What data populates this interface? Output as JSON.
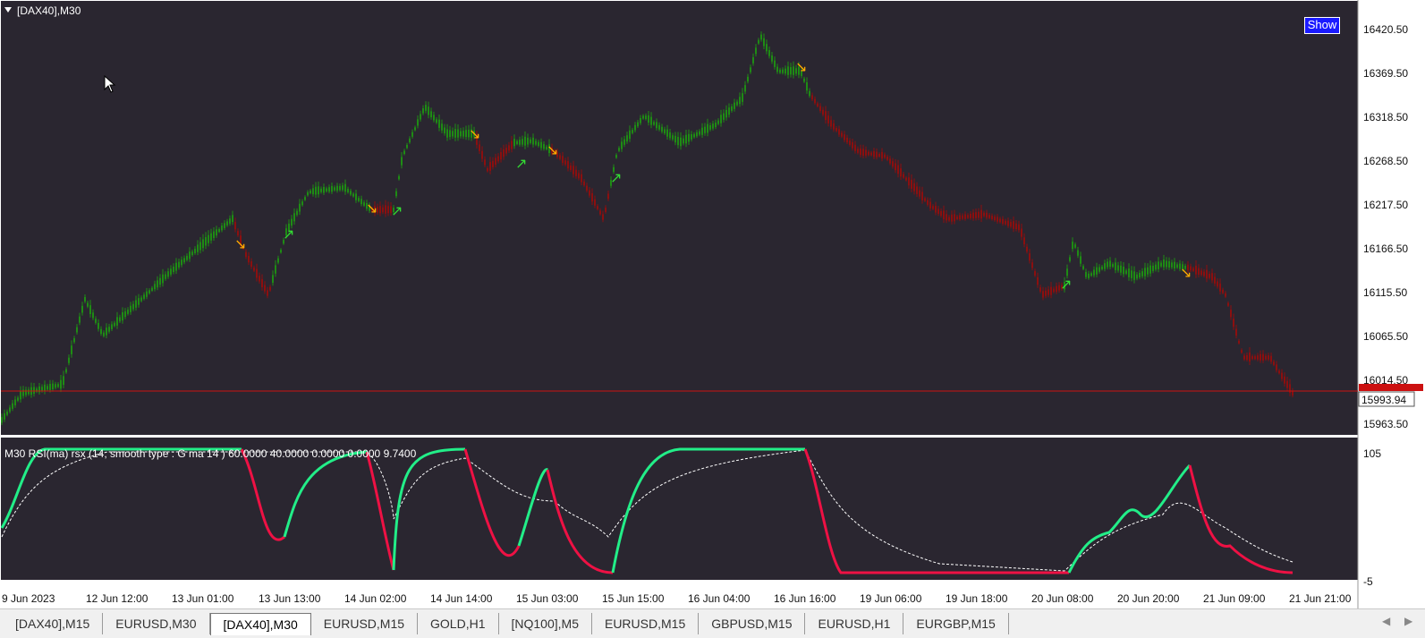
{
  "chart": {
    "title": "[DAX40],M30",
    "show_button": "Show",
    "current_price": "15993.94",
    "price_levels": [
      "16420.50",
      "16369.50",
      "16318.50",
      "16268.50",
      "16217.50",
      "16166.50",
      "16115.50",
      "16065.50",
      "16014.50",
      "15963.50"
    ],
    "time_labels": [
      "9 Jun 2023",
      "12 Jun 12:00",
      "13 Jun 01:00",
      "13 Jun 13:00",
      "14 Jun 02:00",
      "14 Jun 14:00",
      "15 Jun 03:00",
      "15 Jun 15:00",
      "16 Jun 04:00",
      "16 Jun 16:00",
      "19 Jun 06:00",
      "19 Jun 18:00",
      "20 Jun 08:00",
      "20 Jun 20:00",
      "21 Jun 09:00",
      "21 Jun 21:00"
    ]
  },
  "indicator": {
    "label": "M30 RSI(ma) rsx (14, smooth type : G ma  14 ) 60.0000 40.0000 0.0000 0.0000 9.7400",
    "scale_top": "105",
    "scale_bottom": "-5"
  },
  "colors": {
    "background": "#2a2630",
    "bull": "#1e8c14",
    "bear": "#8c0f0f",
    "up_arrow": "#33dd33",
    "down_arrow": "#ffaa00",
    "rsi_up": "#22ee88",
    "rsi_down": "#ee1144",
    "price_line": "#cc1111"
  },
  "tabs": [
    {
      "label": "[DAX40],M15",
      "active": false
    },
    {
      "label": "EURUSD,M30",
      "active": false
    },
    {
      "label": "[DAX40],M30",
      "active": true
    },
    {
      "label": "EURUSD,M15",
      "active": false
    },
    {
      "label": "GOLD,H1",
      "active": false
    },
    {
      "label": "[NQ100],M5",
      "active": false
    },
    {
      "label": "EURUSD,M15",
      "active": false
    },
    {
      "label": "GBPUSD,M15",
      "active": false
    },
    {
      "label": "EURUSD,H1",
      "active": false
    },
    {
      "label": "EURGBP,M15",
      "active": false
    }
  ],
  "icons": {
    "scroll_left": "chevron-left-icon",
    "scroll_right": "chevron-right-icon",
    "collapse": "triangle-down-icon",
    "cursor": "mouse-pointer-icon"
  }
}
